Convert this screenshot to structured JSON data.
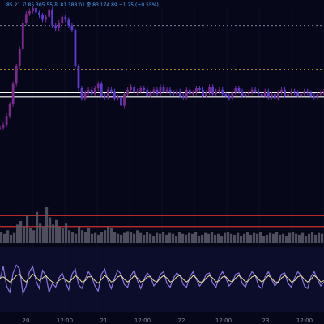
{
  "header": {
    "ohlc_text": "…85.21  고 85.305.55  저 81.388.01  종 83.174.89  +1.25 (+0.55%)"
  },
  "theme": {
    "background": "#07071a",
    "grid": "#1b1f3a",
    "candle_up": "#7a2a8c",
    "candle_down": "#5b3bd0",
    "price_dotted": "#c8a020",
    "white_level": "#ffffff",
    "volume_bar": "#5a5a6a",
    "red_level": "#d0302a",
    "oscillator_main": "#8a74e0",
    "oscillator_signal": "#e8e0a0",
    "axis_text": "#7f8aa3"
  },
  "chart_data": [
    {
      "type": "line",
      "name": "price",
      "x": [
        0,
        1,
        2,
        3,
        4,
        5,
        6,
        7,
        8,
        9,
        10,
        11,
        12,
        13,
        14,
        15,
        16,
        17,
        18,
        19,
        20,
        21,
        22,
        23,
        24,
        25,
        26,
        27,
        28,
        29,
        30,
        31,
        32,
        33,
        34,
        35,
        36,
        37,
        38,
        39,
        40,
        41,
        42,
        43,
        44,
        45,
        46,
        47,
        48,
        49,
        50,
        51,
        52,
        53,
        54,
        55,
        56,
        57,
        58,
        59,
        60,
        61,
        62,
        63,
        64,
        65,
        66,
        67,
        68,
        69,
        70,
        71,
        72,
        73,
        74,
        75,
        76,
        77,
        78,
        79,
        80,
        81,
        82,
        83,
        84,
        85,
        86,
        87,
        88,
        89,
        90,
        91,
        92,
        93,
        94,
        95,
        96,
        97,
        98,
        99
      ],
      "values": [
        18,
        20,
        26,
        34,
        48,
        60,
        72,
        90,
        96,
        98,
        100,
        97,
        95,
        92,
        94,
        99,
        88,
        86,
        90,
        94,
        92,
        88,
        85,
        60,
        45,
        38,
        42,
        44,
        41,
        45,
        48,
        40,
        39,
        44,
        43,
        38,
        39,
        33,
        41,
        44,
        46,
        42,
        43,
        45,
        44,
        40,
        42,
        44,
        41,
        46,
        43,
        44,
        42,
        41,
        43,
        40,
        39,
        44,
        41,
        42,
        45,
        44,
        40,
        42,
        46,
        41,
        43,
        44,
        41,
        40,
        38,
        42,
        45,
        43,
        40,
        41,
        42,
        44,
        43,
        41,
        40,
        43,
        39,
        41,
        38,
        42,
        44,
        40,
        41,
        43,
        42,
        40,
        41,
        43,
        42,
        40,
        39,
        41,
        42,
        43
      ],
      "ylim": [
        0,
        100
      ],
      "levels_dotted": [
        58,
        88
      ],
      "levels_white": [
        42,
        39
      ]
    },
    {
      "type": "bar",
      "name": "volume",
      "values": [
        12,
        10,
        14,
        9,
        11,
        20,
        24,
        18,
        30,
        16,
        14,
        34,
        22,
        18,
        40,
        28,
        20,
        26,
        18,
        16,
        22,
        14,
        12,
        10,
        18,
        14,
        12,
        16,
        10,
        11,
        9,
        12,
        14,
        18,
        16,
        12,
        10,
        9,
        11,
        13,
        12,
        10,
        14,
        11,
        9,
        12,
        10,
        8,
        11,
        10,
        12,
        9,
        11,
        10,
        8,
        12,
        10,
        9,
        11,
        10,
        12,
        8,
        9,
        11,
        10,
        12,
        9,
        10,
        8,
        11,
        12,
        10,
        9,
        11,
        8,
        10,
        12,
        9,
        11,
        10,
        12,
        8,
        9,
        11,
        10,
        12,
        9,
        10,
        8,
        11,
        12,
        10,
        9,
        11,
        8,
        10,
        12,
        9,
        11,
        10
      ],
      "ylim": [
        0,
        80
      ],
      "levels_red": [
        30,
        18
      ]
    },
    {
      "type": "line",
      "name": "oscillator",
      "values": [
        50,
        70,
        40,
        30,
        60,
        72,
        66,
        28,
        40,
        62,
        70,
        48,
        36,
        64,
        56,
        30,
        44,
        38,
        52,
        60,
        46,
        34,
        58,
        66,
        42,
        36,
        50,
        62,
        54,
        40,
        32,
        58,
        66,
        48,
        36,
        52,
        64,
        58,
        42,
        38,
        56,
        64,
        48,
        36,
        50,
        60,
        54,
        40,
        46,
        58,
        62,
        44,
        38,
        52,
        60,
        56,
        42,
        38,
        54,
        62,
        50,
        40,
        46,
        58,
        60,
        44,
        38,
        54,
        62,
        52,
        40,
        46,
        58,
        60,
        44,
        38,
        52,
        62,
        56,
        40,
        36,
        54,
        62,
        50,
        40,
        46,
        58,
        60,
        44,
        38,
        52,
        62,
        56,
        40,
        36,
        54,
        62,
        50,
        40,
        46
      ],
      "signal": [
        52,
        54,
        50,
        46,
        50,
        56,
        58,
        50,
        46,
        52,
        58,
        54,
        48,
        52,
        56,
        50,
        46,
        44,
        48,
        52,
        50,
        46,
        50,
        56,
        52,
        46,
        48,
        54,
        54,
        48,
        44,
        50,
        56,
        52,
        46,
        48,
        54,
        56,
        50,
        46,
        50,
        56,
        52,
        46,
        48,
        54,
        54,
        48,
        46,
        52,
        56,
        52,
        46,
        48,
        54,
        56,
        50,
        46,
        50,
        56,
        52,
        46,
        46,
        52,
        56,
        52,
        46,
        48,
        54,
        54,
        48,
        46,
        52,
        56,
        52,
        46,
        48,
        54,
        56,
        50,
        46,
        50,
        56,
        52,
        46,
        46,
        52,
        56,
        52,
        46,
        48,
        54,
        56,
        50,
        46,
        50,
        56,
        52,
        46,
        48
      ],
      "ylim": [
        0,
        100
      ]
    }
  ],
  "x_axis": {
    "ticks": [
      {
        "label": "20",
        "at": 0.08
      },
      {
        "label": "12:00",
        "at": 0.2
      },
      {
        "label": "21",
        "at": 0.32
      },
      {
        "label": "12:00",
        "at": 0.44
      },
      {
        "label": "22",
        "at": 0.56
      },
      {
        "label": "12:00",
        "at": 0.69
      },
      {
        "label": "23",
        "at": 0.82
      },
      {
        "label": "12:00",
        "at": 0.94
      }
    ]
  }
}
